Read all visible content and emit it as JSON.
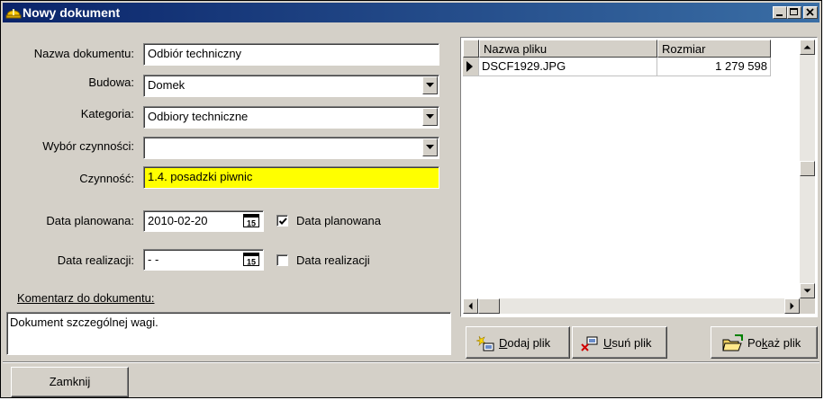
{
  "window": {
    "title": "Nowy dokument",
    "minimize_icon": "minimize-icon",
    "maximize_icon": "maximize-icon",
    "close_icon": "close-icon"
  },
  "form": {
    "nazwa_label": "Nazwa dokumentu:",
    "nazwa_value": "Odbiór techniczny",
    "budowa_label": "Budowa:",
    "budowa_value": "Domek",
    "kategoria_label": "Kategoria:",
    "kategoria_value": "Odbiory techniczne",
    "wybor_label": "Wybór czynności:",
    "wybor_value": "",
    "czynnosc_label": "Czynność:",
    "czynnosc_value": "1.4. posadzki piwnic",
    "czynnosc_bg": "#ffff00",
    "data_planowana_label": "Data planowana:",
    "data_planowana_value": "2010-02-20",
    "data_planowana_checkbox_label": "Data planowana",
    "data_planowana_checked": true,
    "data_realizacji_label": "Data realizacji:",
    "data_realizacji_value": " -  -",
    "data_realizacji_checkbox_label": "Data realizacji",
    "data_realizacji_checked": false,
    "calendar_icon_text": "15",
    "komentarz_label": "Komentarz do dokumentu:",
    "komentarz_value": "Dokument szczególnej wagi."
  },
  "files": {
    "columns": [
      "Nazwa pliku",
      "Rozmiar"
    ],
    "rows": [
      {
        "name": "DSCF1929.JPG",
        "size": "1 279 598"
      }
    ]
  },
  "buttons": {
    "dodaj_prefix": "",
    "dodaj_u": "D",
    "dodaj_rest": "odaj plik",
    "usun_u": "U",
    "usun_rest": "suń plik",
    "pokaz_pre": "Po",
    "pokaz_u": "k",
    "pokaz_rest": "aż plik",
    "zamknij": "Zamknij"
  },
  "colors": {
    "titlebar_start": "#0a246a",
    "titlebar_end": "#3a6ea5",
    "face": "#d4d0c8",
    "highlight_field": "#ffff00"
  }
}
